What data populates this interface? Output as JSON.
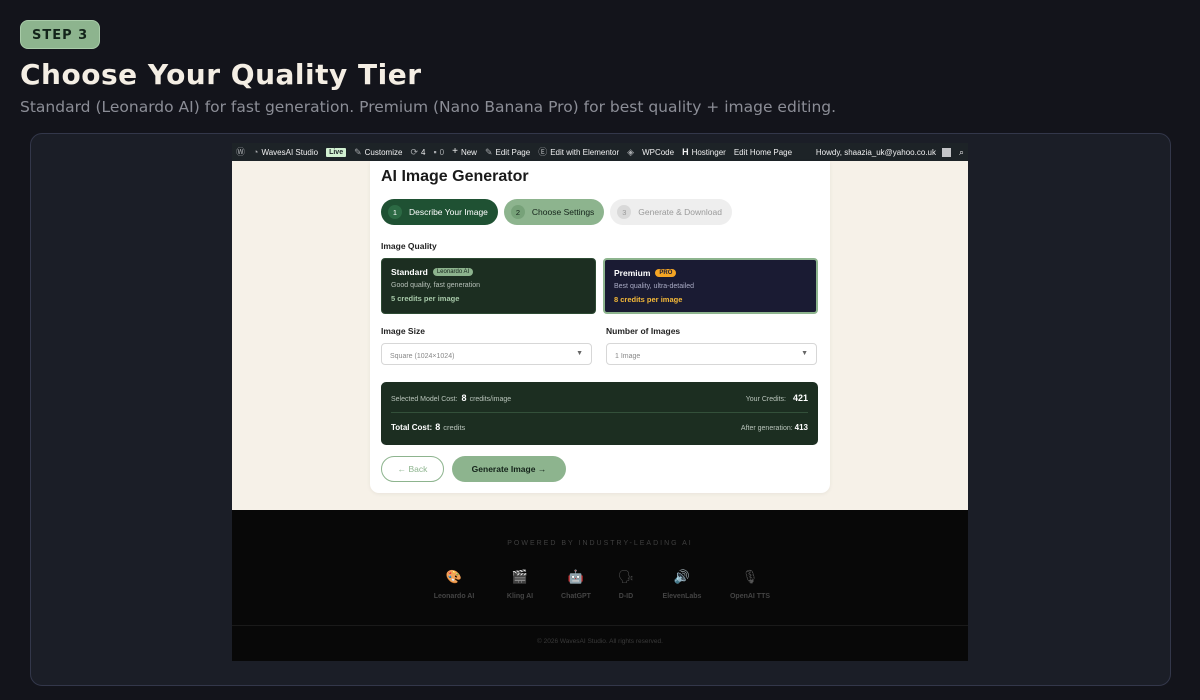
{
  "step_badge": "STEP 3",
  "title": "Choose Your Quality Tier",
  "subtitle": "Standard (Leonardo AI) for fast generation. Premium (Nano Banana Pro) for best quality + image editing.",
  "adminbar": {
    "site": "WavesAI Studio",
    "live": "Live",
    "customize": "Customize",
    "updates": "4",
    "comments": "0",
    "new": "New",
    "edit_page": "Edit Page",
    "elementor": "Edit with Elementor",
    "wpcode": "WPCode",
    "hostinger": "Hostinger",
    "edit_home": "Edit Home Page",
    "howdy": "Howdy, shaazia_uk@yahoo.co.uk"
  },
  "generator": {
    "title": "AI Image Generator",
    "steps": [
      {
        "num": "1",
        "label": "Describe Your Image"
      },
      {
        "num": "2",
        "label": "Choose Settings"
      },
      {
        "num": "3",
        "label": "Generate & Download"
      }
    ],
    "quality_label": "Image Quality",
    "standard": {
      "name": "Standard",
      "tag": "Leonardo AI",
      "desc": "Good quality, fast generation",
      "credits": "5 credits per image"
    },
    "premium": {
      "name": "Premium",
      "tag": "PRO",
      "desc": "Best quality, ultra-detailed",
      "credits": "8 credits per image"
    },
    "size_label": "Image Size",
    "size_value": "Square (1024×1024)",
    "count_label": "Number of Images",
    "count_value": "1 Image",
    "cost": {
      "selected_label": "Selected Model Cost:",
      "selected_value": "8",
      "selected_unit": "credits/image",
      "your_credits_label": "Your Credits:",
      "your_credits_value": "421",
      "total_label": "Total Cost:",
      "total_value": "8",
      "total_unit": "credits",
      "after_label": "After generation:",
      "after_value": "413"
    },
    "back_button": "← Back",
    "generate_button": "Generate Image →"
  },
  "footer": {
    "powered": "POWERED BY INDUSTRY-LEADING AI",
    "providers": [
      {
        "icon": "palette-icon",
        "glyph": "🎨",
        "name": "Leonardo AI"
      },
      {
        "icon": "clapperboard-icon",
        "glyph": "🎬",
        "name": "Kling AI"
      },
      {
        "icon": "robot-icon",
        "glyph": "🤖",
        "name": "ChatGPT"
      },
      {
        "icon": "speaking-head-icon",
        "glyph": "🗣",
        "name": "D-ID"
      },
      {
        "icon": "speaker-icon",
        "glyph": "🔊",
        "name": "ElevenLabs"
      },
      {
        "icon": "microphone-icon",
        "glyph": "🎙",
        "name": "OpenAI TTS"
      }
    ],
    "copyright": "© 2026 WavesAI Studio. All rights reserved."
  }
}
